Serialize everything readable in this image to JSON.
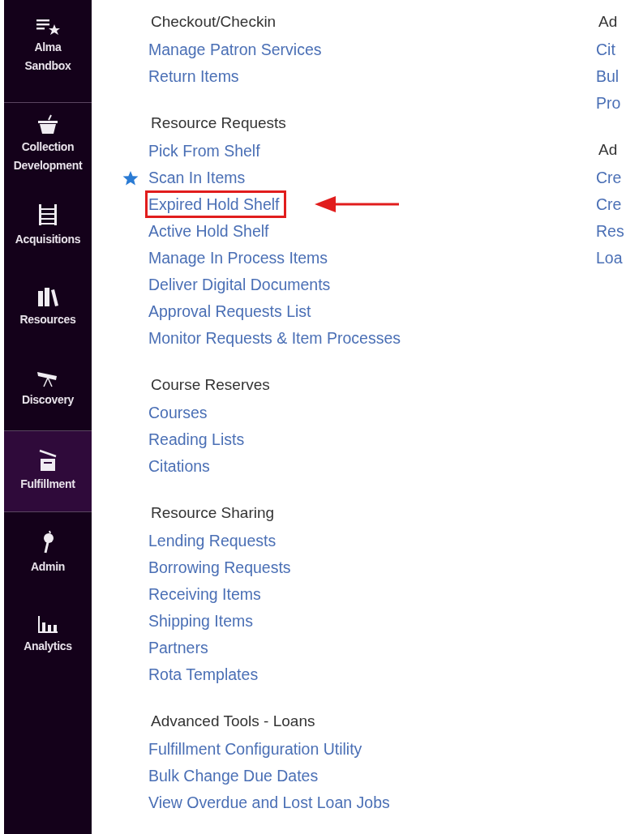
{
  "sidebar": {
    "items": [
      {
        "kind": "sandbox",
        "label": "Alma Sandbox",
        "selected": false
      },
      {
        "kind": "basket",
        "label": "Collection Development",
        "selected": false
      },
      {
        "kind": "abacus",
        "label": "Acquisitions",
        "selected": false
      },
      {
        "kind": "books",
        "label": "Resources",
        "selected": false
      },
      {
        "kind": "telescope",
        "label": "Discovery",
        "selected": false
      },
      {
        "kind": "box",
        "label": "Fulfillment",
        "selected": true
      },
      {
        "kind": "key",
        "label": "Admin",
        "selected": false
      },
      {
        "kind": "chart",
        "label": "Analytics",
        "selected": false
      }
    ]
  },
  "columns": [
    {
      "sections": [
        {
          "title": "Checkout/Checkin",
          "links": [
            {
              "label": "Manage Patron Services",
              "favorite": false,
              "highlighted": false
            },
            {
              "label": "Return Items",
              "favorite": false,
              "highlighted": false
            }
          ]
        },
        {
          "title": "Resource Requests",
          "links": [
            {
              "label": "Pick From Shelf",
              "favorite": false,
              "highlighted": false
            },
            {
              "label": "Scan In Items",
              "favorite": true,
              "highlighted": false
            },
            {
              "label": "Expired Hold Shelf",
              "favorite": false,
              "highlighted": true
            },
            {
              "label": "Active Hold Shelf",
              "favorite": false,
              "highlighted": false
            },
            {
              "label": "Manage In Process Items",
              "favorite": false,
              "highlighted": false
            },
            {
              "label": "Deliver Digital Documents",
              "favorite": false,
              "highlighted": false
            },
            {
              "label": "Approval Requests List",
              "favorite": false,
              "highlighted": false
            },
            {
              "label": "Monitor Requests & Item Processes",
              "favorite": false,
              "highlighted": false
            }
          ]
        },
        {
          "title": "Course Reserves",
          "links": [
            {
              "label": "Courses",
              "favorite": false,
              "highlighted": false
            },
            {
              "label": "Reading Lists",
              "favorite": false,
              "highlighted": false
            },
            {
              "label": "Citations",
              "favorite": false,
              "highlighted": false
            }
          ]
        },
        {
          "title": "Resource Sharing",
          "links": [
            {
              "label": "Lending Requests",
              "favorite": false,
              "highlighted": false
            },
            {
              "label": "Borrowing Requests",
              "favorite": false,
              "highlighted": false
            },
            {
              "label": "Receiving Items",
              "favorite": false,
              "highlighted": false
            },
            {
              "label": "Shipping Items",
              "favorite": false,
              "highlighted": false
            },
            {
              "label": "Partners",
              "favorite": false,
              "highlighted": false
            },
            {
              "label": "Rota Templates",
              "favorite": false,
              "highlighted": false
            }
          ]
        },
        {
          "title": "Advanced Tools - Loans",
          "links": [
            {
              "label": "Fulfillment Configuration Utility",
              "favorite": false,
              "highlighted": false
            },
            {
              "label": "Bulk Change Due Dates",
              "favorite": false,
              "highlighted": false
            },
            {
              "label": "View Overdue and Lost Loan Jobs",
              "favorite": false,
              "highlighted": false
            }
          ]
        }
      ]
    },
    {
      "sections": [
        {
          "title": "Ad",
          "links": [
            {
              "label": "Cit"
            },
            {
              "label": "Bul"
            },
            {
              "label": "Pro"
            }
          ]
        },
        {
          "title": "Ad",
          "links": [
            {
              "label": "Cre"
            },
            {
              "label": "Cre"
            },
            {
              "label": "Res"
            },
            {
              "label": "Loa"
            }
          ]
        }
      ]
    }
  ]
}
